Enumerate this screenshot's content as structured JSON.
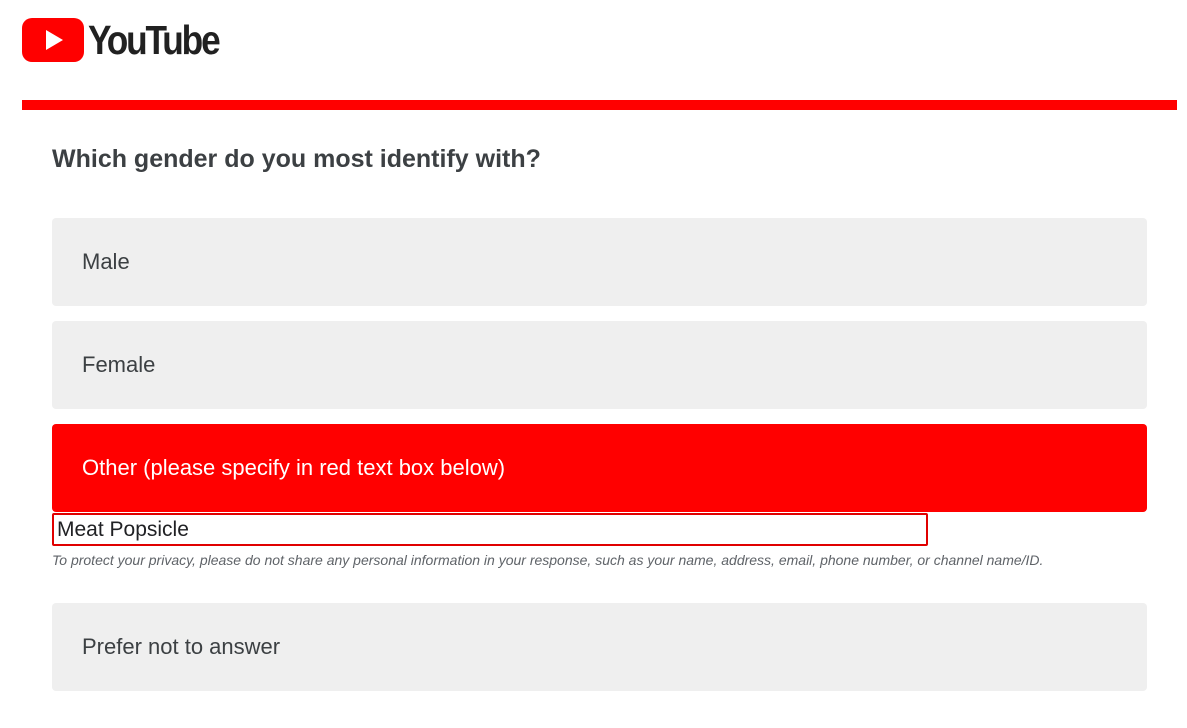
{
  "brand": {
    "name": "YouTube",
    "logo_icon": "youtube-play-icon",
    "colors": {
      "brand_red": "#ff0000",
      "option_bg": "#efefef",
      "text_dark": "#3c4043"
    }
  },
  "survey": {
    "question": "Which gender do you most identify with?",
    "options": [
      {
        "label": "Male",
        "selected": false
      },
      {
        "label": "Female",
        "selected": false
      },
      {
        "label": "Other (please specify in red text box below)",
        "selected": true
      },
      {
        "label": "Prefer not to answer",
        "selected": false
      }
    ],
    "other_input": {
      "value": "Meat Popsicle",
      "placeholder": ""
    },
    "privacy_note": "To protect your privacy, please do not share any personal information in your response, such as your name, address, email, phone number, or channel name/ID."
  }
}
